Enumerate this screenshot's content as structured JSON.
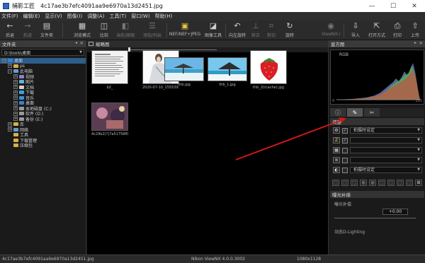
{
  "window": {
    "app_name": "捕影工匠",
    "filename": "4c17ae3b7efc4091aa9e6970a13d2451.jpg",
    "minimize": "—",
    "maximize": "☐",
    "close": "✕"
  },
  "menu": [
    "文件(F)",
    "编辑(E)",
    "显示(V)",
    "图像(I)",
    "调整(A)",
    "工具(T)",
    "窗口(W)",
    "帮助(H)"
  ],
  "toolbar": {
    "back": "后退",
    "forward": "前进",
    "folders": "文件夹",
    "browser_mode": "浏览模式",
    "compare": "比较",
    "before_after": "当前/原图",
    "add_list": "添加/列出",
    "nef_jpeg": "NEF/NEF+JPEG",
    "edit_tools": "图像工具",
    "rotate_left": "向左旋转",
    "straighten": "矫正",
    "crop": "剪切",
    "rotate": "旋转",
    "viewnx": "ViewNX-i",
    "import": "导入",
    "open_with": "打开方式",
    "print": "打印",
    "upload": "上传"
  },
  "icons": {
    "back": "←",
    "forward": "→",
    "folders": "▤",
    "browser_mode": "▦",
    "compare": "◫",
    "before_after": "◧",
    "add_list": "☰",
    "nef_jpeg": "▣",
    "edit_tools": "◪",
    "rotate_left": "↶",
    "straighten": "⊥",
    "crop": "⌗",
    "rotate": "↻",
    "viewnx": "◉",
    "import": "⇩",
    "open_with": "⇱",
    "print": "⎙",
    "upload": "⇧"
  },
  "left_panel": {
    "header": "文件夹",
    "path": "D:\\tools\\桌面",
    "tree": [
      {
        "label": "桌面",
        "level": 0,
        "exp": "−",
        "color": "#3a7fd5",
        "selected": true
      },
      {
        "label": "ps",
        "level": 1,
        "exp": "+",
        "color": "#d8b04a"
      },
      {
        "label": "此电脑",
        "level": 1,
        "exp": "−",
        "color": "#5f9fd6"
      },
      {
        "label": "视频",
        "level": 2,
        "exp": "+",
        "color": "#8a7fd0"
      },
      {
        "label": "图片",
        "level": 2,
        "exp": "+",
        "color": "#5fb3d6"
      },
      {
        "label": "文档",
        "level": 2,
        "exp": "+",
        "color": "#cfcfcf"
      },
      {
        "label": "下载",
        "level": 2,
        "exp": "+",
        "color": "#3aa0e0"
      },
      {
        "label": "音乐",
        "level": 2,
        "exp": "+",
        "color": "#3a8fd0"
      },
      {
        "label": "桌面",
        "level": 2,
        "exp": "+",
        "color": "#3a7fd5"
      },
      {
        "label": "本地磁盘 (C:)",
        "level": 2,
        "exp": "+",
        "color": "#9a9a9a"
      },
      {
        "label": "软件 (D:)",
        "level": 2,
        "exp": "+",
        "color": "#9a9a9a"
      },
      {
        "label": "备份 (E:)",
        "level": 2,
        "exp": "+",
        "color": "#9a9a9a"
      },
      {
        "label": "库",
        "level": 1,
        "exp": "+",
        "color": "#d8b04a"
      },
      {
        "label": "网络",
        "level": 1,
        "exp": "+",
        "color": "#5f9fd6"
      },
      {
        "label": "工具",
        "level": 1,
        "exp": "",
        "color": "#d8b04a"
      },
      {
        "label": "下载管理",
        "level": 1,
        "exp": "",
        "color": "#d8b04a"
      },
      {
        "label": "压缩包",
        "level": 1,
        "exp": "",
        "color": "#d8b04a"
      }
    ]
  },
  "center": {
    "tab": "缩略图",
    "thumbs": [
      {
        "caption": "b2_"
      },
      {
        "caption": "2020-07-10_155539.jpg"
      },
      {
        "caption": "thb.jpg"
      },
      {
        "caption": "thb_1.jpg"
      },
      {
        "caption": "thb_2(rcache).jpg"
      },
      {
        "caption": "4c29b2(?)7a51758899*82.jpg"
      }
    ]
  },
  "right": {
    "histogram_header": "直方图",
    "histogram_mode": "RGB",
    "h0": "0",
    "h255": "255",
    "tab_icons": [
      "ⓘ",
      "✎",
      "✂"
    ],
    "adjust_header": "调整",
    "preset": "拍摄时设定",
    "preset2": "拍摄时设定",
    "row_icons": [
      "⚙",
      "Z",
      "▦",
      "≋",
      "◐"
    ],
    "checks": [
      "✓",
      "✓",
      "",
      "",
      ""
    ],
    "bottom_icons": [
      "⬚",
      "⬚",
      "⬚",
      "◎",
      "◎",
      "⬚",
      "⬚",
      "⬚",
      "⬚",
      "⊞"
    ],
    "exposure_header": "曝光补偿",
    "exposure_label": "曝光补偿",
    "exposure_value": "+0.00",
    "dlighting_label": "动态D-Lighting"
  },
  "status": {
    "file": "4c17ae3b7efc4091aa9e6970a13d2451.jpg",
    "app": "Nikon ViewNX 4.0.0.3002",
    "size": "1080x1128"
  }
}
